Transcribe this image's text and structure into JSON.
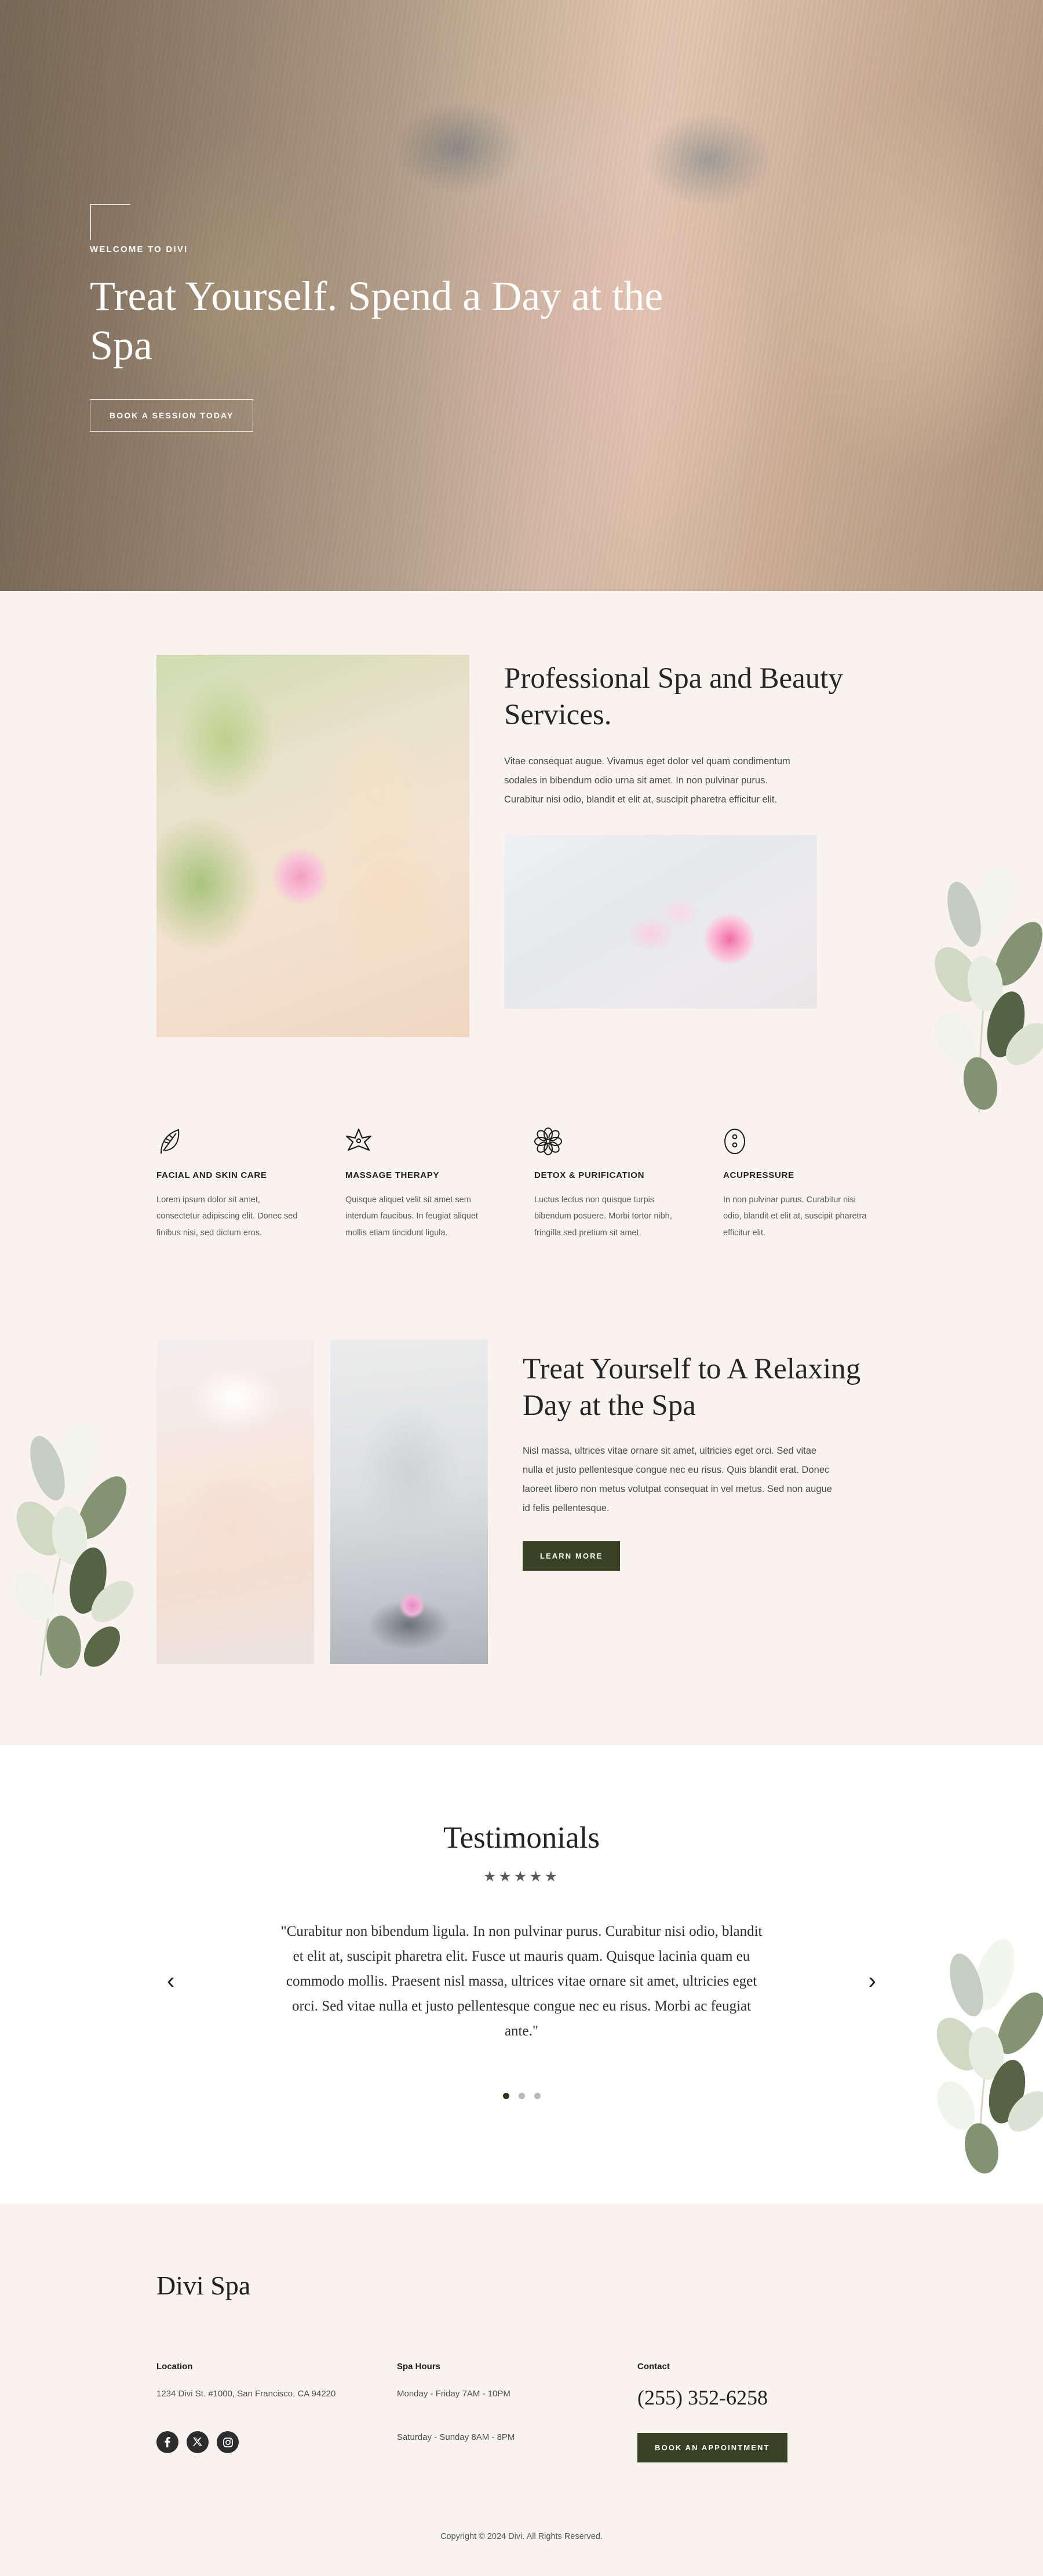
{
  "hero": {
    "eyebrow": "WELCOME TO DIVI",
    "title": "Treat Yourself. Spend a Day at the Spa",
    "cta": "BOOK A SESSION TODAY"
  },
  "services": {
    "heading": "Professional Spa and Beauty Services.",
    "paragraph": "Vitae consequat augue. Vivamus eget dolor vel quam condimentum sodales in bibendum odio urna sit amet. In non pulvinar purus. Curabitur nisi odio, blandit et elit at, suscipit pharetra efficitur elit.",
    "main_image_alt": "woman-smelling-rose-photo",
    "secondary_image_alt": "pink-rose-on-marble-photo"
  },
  "features": [
    {
      "icon": "leaf-icon",
      "title": "FACIAL AND SKIN CARE",
      "text": "Lorem ipsum dolor sit amet, consectetur adipiscing elit. Donec sed finibus nisi, sed dictum eros."
    },
    {
      "icon": "star-flower-icon",
      "title": "MASSAGE THERAPY",
      "text": "Quisque aliquet velit sit amet sem interdum faucibus. In feugiat aliquet mollis etiam tincidunt ligula."
    },
    {
      "icon": "flower-petals-icon",
      "title": "DETOX & PURIFICATION",
      "text": "Luctus lectus non quisque turpis bibendum posuere. Morbi tortor nibh, fringilla sed pretium sit amet."
    },
    {
      "icon": "acupressure-circle-icon",
      "title": "ACUPRESSURE",
      "text": "In non pulvinar purus. Curabitur nisi odio, blandit et elit at, suscipit pharetra efficitur elit."
    }
  ],
  "relax": {
    "heading": "Treat Yourself to A Relaxing Day at the Spa",
    "paragraph": "Nisl massa, ultrices vitae ornare sit amet, ultricies eget orci. Sed vitae nulla et justo pellentesque congue nec eu risus. Quis blandit erat. Donec laoreet libero non metus volutpat consequat in vel metus. Sed non augue id felis pellentesque.",
    "cta": "LEARN MORE",
    "image_a_alt": "woman-with-towel-turban-photo",
    "image_b_alt": "buddha-statue-with-stones-photo"
  },
  "testimonials": {
    "heading": "Testimonials",
    "stars": "★★★★★",
    "quote": "\"Curabitur non bibendum ligula. In non pulvinar purus. Curabitur nisi odio, blandit et elit at, suscipit pharetra elit. Fusce ut mauris quam. Quisque lacinia quam eu commodo mollis. Praesent nisl massa, ultrices vitae ornare sit amet, ultricies eget orci. Sed vitae nulla et justo pellentesque congue nec eu risus. Morbi ac feugiat ante.\"",
    "prev": "‹",
    "next": "›",
    "slide_count": 3,
    "active_slide": 1
  },
  "footer": {
    "brand": "Divi Spa",
    "location_heading": "Location",
    "location_text": "1234 Divi St. #1000, San Francisco, CA 94220",
    "hours_heading": "Spa Hours",
    "hours_weekday": "Monday - Friday 7AM - 10PM",
    "hours_weekend": "Saturday - Sunday 8AM - 8PM",
    "contact_heading": "Contact",
    "phone": "(255) 352-6258",
    "cta": "BOOK AN APPOINTMENT",
    "socials": [
      "facebook-icon",
      "x-twitter-icon",
      "instagram-icon"
    ],
    "copyright": "Copyright © 2024 Divi. All Rights Reserved."
  },
  "colors": {
    "cream": "#f8f3ef",
    "dark_green": "#394023",
    "text_dark": "#1f1f1f"
  }
}
